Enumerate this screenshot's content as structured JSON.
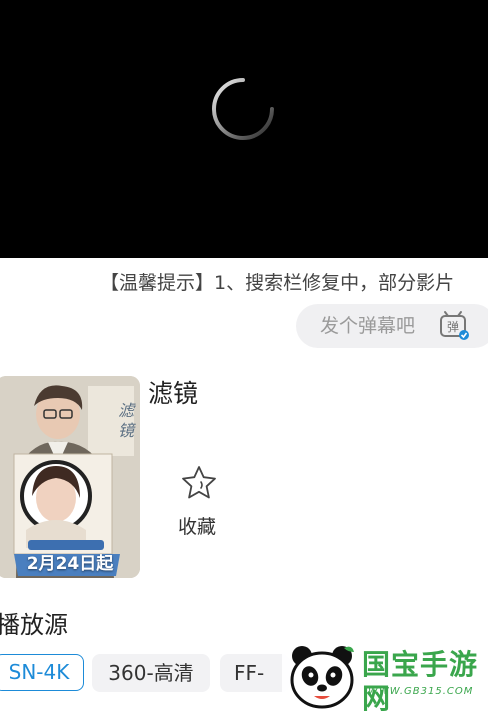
{
  "player": {
    "state": "loading",
    "spinner_icon": "loading-spinner-icon"
  },
  "notice": {
    "text": "【温馨提示】1、搜索栏修复中，部分影片"
  },
  "danmaku": {
    "placeholder": "发个弹幕吧",
    "icon": "danmaku-toggle-icon",
    "icon_glyph": "弹"
  },
  "video": {
    "poster_date": "2月24日起",
    "title": "滤镜",
    "favorite_label": "收藏",
    "favorite_icon": "star-icon"
  },
  "sources": {
    "heading": "播放源",
    "items": [
      {
        "label": "SN-4K",
        "active": true
      },
      {
        "label": "360-高清",
        "active": false
      },
      {
        "label": "FF-",
        "active": false
      }
    ]
  },
  "watermark": {
    "name": "国宝手游网",
    "url": "WWW.GB315.COM"
  },
  "colors": {
    "accent": "#1d8bd8",
    "player_bg": "#000000",
    "pill_bg": "#f0f0f2",
    "watermark_green": "#3aa64c"
  }
}
